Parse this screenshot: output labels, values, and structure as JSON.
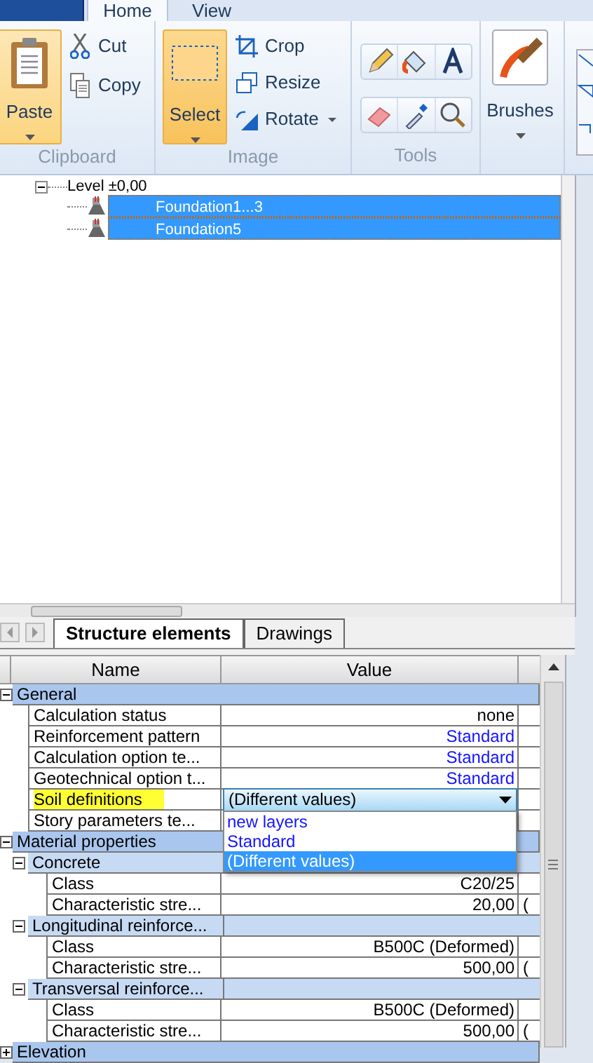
{
  "ribbon": {
    "tabs": [
      {
        "label": "Home",
        "selected": true
      },
      {
        "label": "View",
        "selected": false
      }
    ],
    "clipboard": {
      "label": "Clipboard",
      "paste": "Paste",
      "cut": "Cut",
      "copy": "Copy"
    },
    "image": {
      "label": "Image",
      "select": {
        "label": "Select",
        "selected": true
      },
      "crop": "Crop",
      "resize": "Resize",
      "rotate": "Rotate"
    },
    "tools": {
      "label": "Tools"
    },
    "brushes": {
      "label": "Brushes"
    }
  },
  "tree": [
    {
      "label": "Level ±0,00",
      "expanded": true,
      "children": [
        {
          "label": "Foundation1...3",
          "selected": true
        },
        {
          "label": "Foundation5",
          "selected": true
        }
      ]
    }
  ],
  "document_tabs": [
    {
      "label": "Structure elements",
      "selected": true
    },
    {
      "label": "Drawings",
      "selected": false
    }
  ],
  "property_grid": {
    "columns": [
      "Name",
      "Value"
    ],
    "categories": [
      {
        "label": "General",
        "expanded": true,
        "properties": [
          {
            "name": "Calculation status",
            "value": "none",
            "link": false,
            "highlighted": false
          },
          {
            "name": "Reinforcement pattern",
            "value": "Standard",
            "link": true,
            "highlighted": false
          },
          {
            "name": "Calculation option te...",
            "value": "Standard",
            "link": true,
            "highlighted": false
          },
          {
            "name": "Geotechnical option t...",
            "value": "Standard",
            "link": true,
            "highlighted": false
          },
          {
            "name": "Soil definitions",
            "highlighted": true,
            "dropdown": {
              "value": "(Different values)",
              "expanded": true,
              "options": [
                {
                  "label": "new layers",
                  "selected": false
                },
                {
                  "label": "Standard",
                  "selected": false
                },
                {
                  "label": "(Different values)",
                  "selected": true
                }
              ]
            }
          },
          {
            "name": "Story parameters te...",
            "highlighted": false
          }
        ]
      },
      {
        "label": "Material properties",
        "expanded": true,
        "groups": [
          {
            "label": "Concrete",
            "expanded": true,
            "properties": [
              {
                "name": "Class",
                "value": "C20/25",
                "link": false,
                "highlighted": false
              },
              {
                "name": "Characteristic stre...",
                "value": "20,00",
                "unit": "(",
                "link": false,
                "highlighted": false
              }
            ]
          },
          {
            "label": "Longitudinal reinforce...",
            "expanded": true,
            "properties": [
              {
                "name": "Class",
                "value": "B500C (Deformed)",
                "link": false,
                "highlighted": false
              },
              {
                "name": "Characteristic stre...",
                "value": "500,00",
                "unit": "(",
                "link": false,
                "highlighted": false
              }
            ]
          },
          {
            "label": "Transversal reinforce...",
            "expanded": true,
            "properties": [
              {
                "name": "Class",
                "value": "B500C (Deformed)",
                "link": false,
                "highlighted": false
              },
              {
                "name": "Characteristic stre...",
                "value": "500,00",
                "unit": "(",
                "link": false,
                "highlighted": false
              }
            ]
          }
        ]
      },
      {
        "label": "Elevation",
        "expanded": false
      }
    ]
  }
}
